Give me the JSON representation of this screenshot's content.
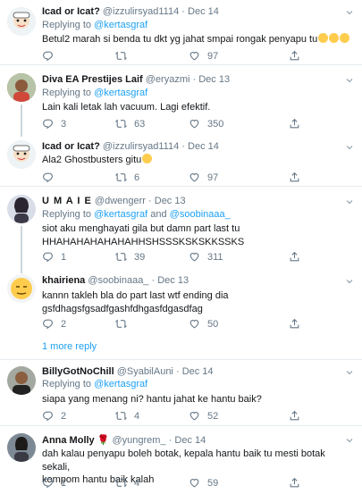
{
  "tweets": [
    {
      "name": "Icad or Icat?",
      "handle": "@izzulirsyad1114",
      "date": "Dec 14",
      "replying_prefix": "Replying to",
      "replying_to": "@kertasgraf",
      "text": "Betul2 marah si benda tu dkt yg jahat smpai rongak penyapu tu",
      "reply_count": "",
      "retweet_count": "",
      "like_count": "97"
    },
    {
      "name": "Diva EA Prestijes Laif",
      "handle": "@eryazmi",
      "date": "Dec 13",
      "replying_prefix": "Replying to",
      "replying_to": "@kertasgraf",
      "text": "Lain kali letak lah vacuum. Lagi efektif.",
      "reply_count": "3",
      "retweet_count": "63",
      "like_count": "350"
    },
    {
      "name": "Icad or Icat?",
      "handle": "@izzulirsyad1114",
      "date": "Dec 14",
      "text": "Ala2 Ghostbusters gitu",
      "reply_count": "",
      "retweet_count": "6",
      "like_count": "97"
    },
    {
      "name": "U M A I E",
      "handle": "@dwengerr",
      "date": "Dec 13",
      "replying_prefix": "Replying to",
      "replying_to": "@kertasgraf",
      "replying_and": "and",
      "replying_to2": "@soobinaaa_",
      "text_line1": "siot aku menghayati gila but damn part last tu",
      "text_line2": "HHAHAHAHAHAHAHHSHSSSKSKSKKSSKS",
      "reply_count": "1",
      "retweet_count": "39",
      "like_count": "311"
    },
    {
      "name": "khairiena",
      "handle": "@soobinaaa_",
      "date": "Dec 13",
      "text_line1": "kannn takleh bla do part last wtf ending dia",
      "text_line2": "gsfdhagsfgsadfgashfdhgasfdgasdfag",
      "reply_count": "2",
      "retweet_count": "",
      "like_count": "50",
      "more_replies": "1 more reply"
    },
    {
      "name": "BillyGotNoChill",
      "handle": "@SyabilAuni",
      "date": "Dec 14",
      "replying_prefix": "Replying to",
      "replying_to": "@kertasgraf",
      "text": "siapa yang menang ni? hantu jahat ke hantu baik?",
      "reply_count": "2",
      "retweet_count": "4",
      "like_count": "52"
    },
    {
      "name": "Anna Molly",
      "handle": "@yungrem_",
      "date": "Dec 14",
      "text_line1": "dah kalau penyapu boleh botak, kepala hantu baik tu mesti botak sekali,",
      "text_line2": "kompom hantu baik kalah",
      "reply_count": "1",
      "retweet_count": "4",
      "like_count": "59"
    }
  ],
  "separator": "·",
  "icons": [
    "reply-icon",
    "retweet-icon",
    "like-icon",
    "share-icon",
    "chevron-down-icon"
  ],
  "colors": {
    "link": "#1da1f2",
    "muted": "#657786",
    "divider": "#e6ecf0"
  }
}
